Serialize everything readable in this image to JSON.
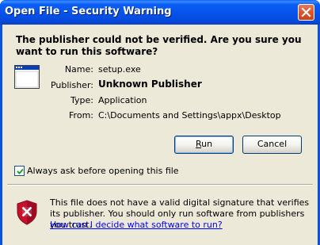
{
  "window": {
    "title": "Open File - Security Warning"
  },
  "question": "The publisher could not be verified.  Are you sure you want to run this software?",
  "fields": [
    {
      "label": "Name:",
      "value": "setup.exe"
    },
    {
      "label": "Publisher:",
      "value": "Unknown Publisher"
    },
    {
      "label": "Type:",
      "value": "Application"
    },
    {
      "label": "From:",
      "value": "C:\\Documents and Settings\\appx\\Desktop"
    }
  ],
  "buttons": {
    "run_label": "Run",
    "run_mnemonic": "R",
    "cancel_label": "Cancel"
  },
  "checkbox": {
    "label": "Always ask before opening this file",
    "checked": true
  },
  "footer": {
    "text": "This file does not have a valid digital signature that verifies its publisher.  You should only run software from publishers you trust.",
    "link": "How can I decide what software to run?"
  },
  "icons": {
    "close": "close-icon",
    "app": "application-icon",
    "shield": "warning-shield-icon",
    "check": "checkmark-icon"
  },
  "colors": {
    "titlebar": "#0a53e1",
    "dialog_bg": "#ece9d8",
    "close_button": "#d9562f",
    "link": "#0000ff",
    "shield": "#c8102e"
  }
}
